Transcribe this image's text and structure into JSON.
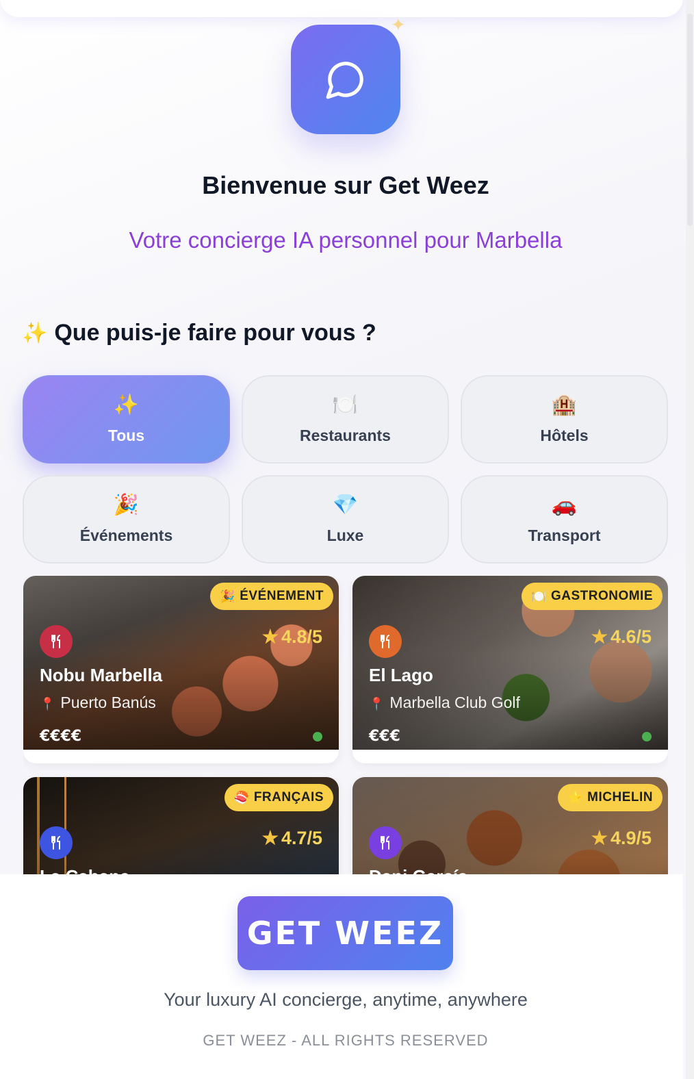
{
  "header": {
    "logo_icon": "chat-bubble-icon",
    "title": "Bienvenue sur Get Weez",
    "subtitle": "Votre concierge IA personnel pour Marbella"
  },
  "section": {
    "icon": "✨",
    "title": "Que puis-je faire pour vous ?"
  },
  "categories": [
    {
      "icon": "✨",
      "label": "Tous",
      "active": true
    },
    {
      "icon": "🍽️",
      "label": "Restaurants",
      "active": false
    },
    {
      "icon": "🏨",
      "label": "Hôtels",
      "active": false
    },
    {
      "icon": "🎉",
      "label": "Événements",
      "active": false
    },
    {
      "icon": "💎",
      "label": "Luxe",
      "active": false
    },
    {
      "icon": "🚗",
      "label": "Transport",
      "active": false
    }
  ],
  "cards": [
    {
      "badge_icon": "🎉",
      "badge": "ÉVÉNEMENT",
      "type_icon_color": "#c62f45",
      "rating": "4.8/5",
      "name": "Nobu Marbella",
      "location": "Puerto Banús",
      "price": "€€€€"
    },
    {
      "badge_icon": "🍽️",
      "badge": "GASTRONOMIE",
      "type_icon_color": "#e06a2c",
      "rating": "4.6/5",
      "name": "El Lago",
      "location": "Marbella Club Golf",
      "price": "€€€"
    },
    {
      "badge_icon": "🍣",
      "badge": "FRANÇAIS",
      "type_icon_color": "#3e55e2",
      "rating": "4.7/5",
      "name": "La Cabane",
      "location": "",
      "price": ""
    },
    {
      "badge_icon": "⭐",
      "badge": "MICHELIN",
      "type_icon_color": "#7a3fe0",
      "rating": "4.9/5",
      "name": "Dani García",
      "location": "",
      "price": ""
    }
  ],
  "footer": {
    "button_label": "GET WEEZ",
    "tagline": "Your luxury AI concierge, anytime, anywhere",
    "copyright": "GET WEEZ - ALL RIGHTS RESERVED"
  },
  "colors": {
    "accent_start": "#7a60ea",
    "accent_end": "#4f82ee",
    "subtitle": "#8b3fd9",
    "badge": "#f8cf46",
    "rating": "#f6d55c"
  }
}
